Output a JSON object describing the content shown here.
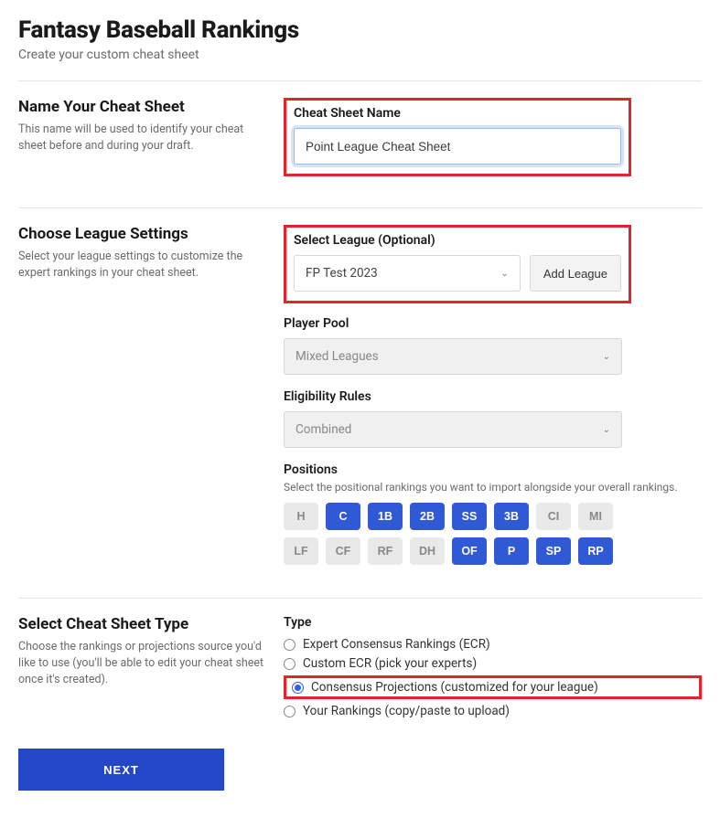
{
  "header": {
    "title": "Fantasy Baseball Rankings",
    "subtitle": "Create your custom cheat sheet"
  },
  "name_section": {
    "heading": "Name Your Cheat Sheet",
    "desc": "This name will be used to identify your cheat sheet before and during your draft.",
    "field_label": "Cheat Sheet Name",
    "value": "Point League Cheat Sheet"
  },
  "league_section": {
    "heading": "Choose League Settings",
    "desc": "Select your league settings to customize the expert rankings in your cheat sheet.",
    "select_league_label": "Select League (Optional)",
    "select_league_value": "FP Test 2023",
    "add_league_label": "Add League",
    "player_pool_label": "Player Pool",
    "player_pool_value": "Mixed Leagues",
    "eligibility_label": "Eligibility Rules",
    "eligibility_value": "Combined",
    "positions_label": "Positions",
    "positions_desc": "Select the positional rankings you want to import alongside your overall rankings.",
    "positions": [
      {
        "label": "H",
        "on": false
      },
      {
        "label": "C",
        "on": true
      },
      {
        "label": "1B",
        "on": true
      },
      {
        "label": "2B",
        "on": true
      },
      {
        "label": "SS",
        "on": true
      },
      {
        "label": "3B",
        "on": true
      },
      {
        "label": "CI",
        "on": false
      },
      {
        "label": "MI",
        "on": false
      },
      {
        "label": "LF",
        "on": false
      },
      {
        "label": "CF",
        "on": false
      },
      {
        "label": "RF",
        "on": false
      },
      {
        "label": "DH",
        "on": false
      },
      {
        "label": "OF",
        "on": true
      },
      {
        "label": "P",
        "on": true
      },
      {
        "label": "SP",
        "on": true
      },
      {
        "label": "RP",
        "on": true
      }
    ]
  },
  "type_section": {
    "heading": "Select Cheat Sheet Type",
    "desc": "Choose the rankings or projections source you'd like to use (you'll be able to edit your cheat sheet once it's created).",
    "field_label": "Type",
    "options": [
      {
        "label": "Expert Consensus Rankings (ECR)",
        "checked": false,
        "highlight": false
      },
      {
        "label": "Custom ECR (pick your experts)",
        "checked": false,
        "highlight": false
      },
      {
        "label": "Consensus Projections (customized for your league)",
        "checked": true,
        "highlight": true
      },
      {
        "label": "Your Rankings (copy/paste to upload)",
        "checked": false,
        "highlight": false
      }
    ]
  },
  "next_label": "NEXT"
}
